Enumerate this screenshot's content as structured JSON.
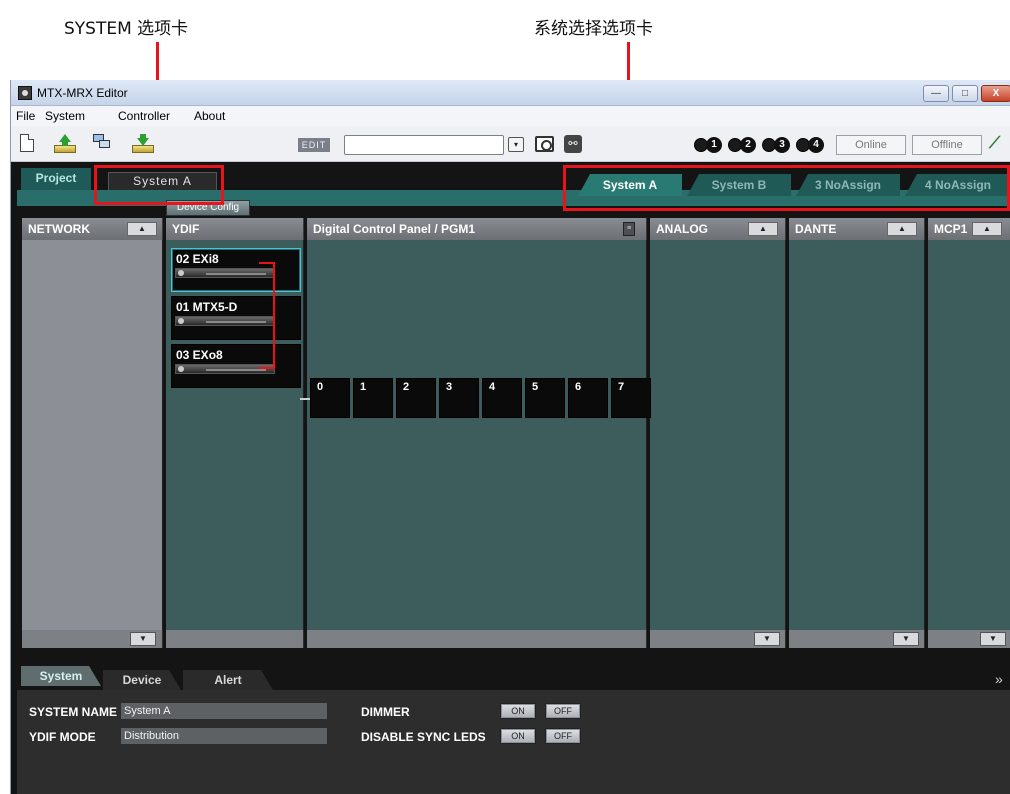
{
  "annotations": {
    "system_tab_label": "SYSTEM 选项卡",
    "system_select_label": "系统选择选项卡"
  },
  "window": {
    "title": "MTX-MRX Editor",
    "min_label": "—",
    "max_label": "□",
    "close_label": "X"
  },
  "menu": {
    "file": "File",
    "system": "System",
    "controller": "Controller",
    "about": "About"
  },
  "toolbar": {
    "edit_label": "EDIT",
    "preset_value": "",
    "dropdown_glyph": "▾",
    "leds": [
      "1",
      "2",
      "3",
      "4"
    ],
    "online_label": "Online",
    "offline_label": "Offline"
  },
  "tabs": {
    "project_label": "Project",
    "system_tab_label": "System A"
  },
  "system_select": [
    {
      "label": "System A",
      "active": true
    },
    {
      "label": "System B",
      "active": false
    },
    {
      "label": "3 NoAssign",
      "active": false
    },
    {
      "label": "4 NoAssign",
      "active": false
    }
  ],
  "device_config_label": "Device Config",
  "columns": {
    "network": "NETWORK",
    "ydif": "YDIF",
    "dcp": "Digital Control Panel / PGM1",
    "analog": "ANALOG",
    "dante": "DANTE",
    "mcp1": "MCP1"
  },
  "devices": [
    {
      "name": "02 EXi8"
    },
    {
      "name": "01 MTX5-D"
    },
    {
      "name": "03 EXo8"
    }
  ],
  "dcp_slots": [
    "0",
    "1",
    "2",
    "3",
    "4",
    "5",
    "6",
    "7"
  ],
  "bottom": {
    "tabs": [
      "System",
      "Device",
      "Alert"
    ],
    "system_name_label": "SYSTEM NAME",
    "system_name_value": "System A",
    "ydif_mode_label": "YDIF MODE",
    "ydif_mode_value": "Distribution",
    "dimmer_label": "DIMMER",
    "disable_sync_label": "DISABLE SYNC LEDS",
    "on_label": "ON",
    "off_label": "OFF"
  }
}
